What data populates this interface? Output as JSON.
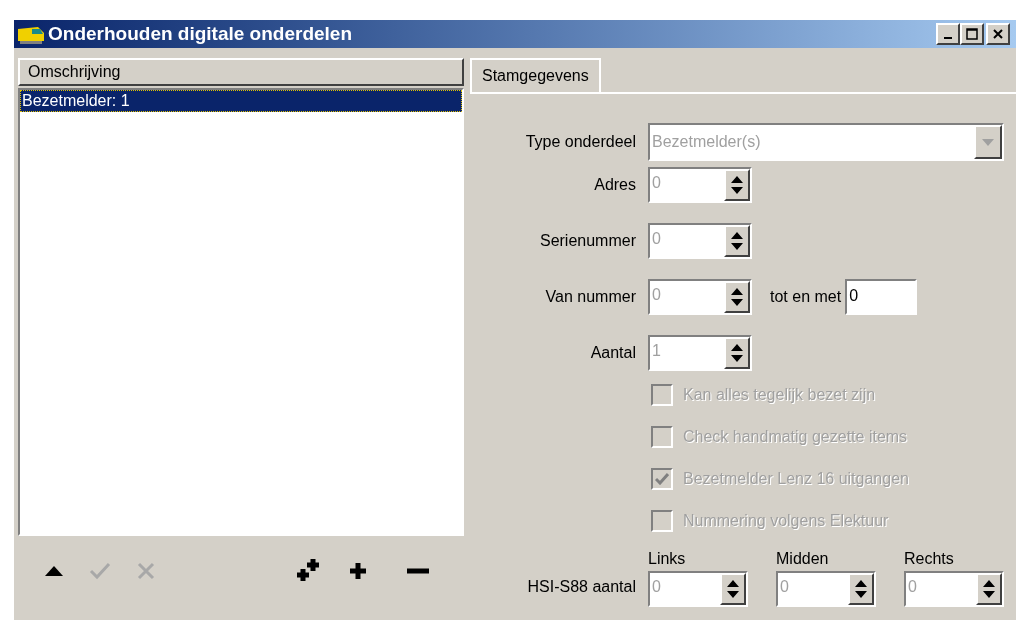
{
  "window": {
    "title": "Onderhouden digitale onderdelen"
  },
  "list": {
    "header": "Omschrijving",
    "items": [
      {
        "label": "Bezetmelder: 1",
        "selected": true
      }
    ]
  },
  "toolbar": [
    {
      "kind": "up",
      "disabled": false
    },
    {
      "kind": "check",
      "disabled": true
    },
    {
      "kind": "cross",
      "disabled": true
    },
    {
      "kind": "add-multiple",
      "disabled": false
    },
    {
      "kind": "add",
      "disabled": false
    },
    {
      "kind": "remove",
      "disabled": false
    }
  ],
  "tabs": [
    {
      "label": "Stamgegevens",
      "selected": true
    }
  ],
  "type_field": {
    "label": "Type onderdeel",
    "value": "Bezetmelder(s)",
    "disabled": true
  },
  "spin_fields": [
    {
      "label": "Adres",
      "value": "0",
      "disabled": true
    },
    {
      "label": "Serienummer",
      "value": "0",
      "disabled": true
    },
    {
      "label": "Van nummer",
      "value": "0",
      "disabled": true,
      "extra": {
        "label": "tot en met",
        "value": "0"
      }
    },
    {
      "label": "Aantal",
      "value": "1",
      "disabled": true
    }
  ],
  "checkboxes": [
    {
      "label": "Kan alles tegelijk bezet zijn",
      "checked": false,
      "disabled": true
    },
    {
      "label": "Check handmatig gezette items",
      "checked": false,
      "disabled": true
    },
    {
      "label": "Bezetmelder Lenz 16 uitgangen",
      "checked": true,
      "disabled": true
    },
    {
      "label": "Nummering volgens Elektuur",
      "checked": false,
      "disabled": true
    }
  ],
  "hsi": {
    "label": "HSI-S88 aantal",
    "columns": [
      {
        "label": "Links",
        "value": "0",
        "disabled": true
      },
      {
        "label": "Midden",
        "value": "0",
        "disabled": true
      },
      {
        "label": "Rechts",
        "value": "0",
        "disabled": true
      }
    ]
  }
}
